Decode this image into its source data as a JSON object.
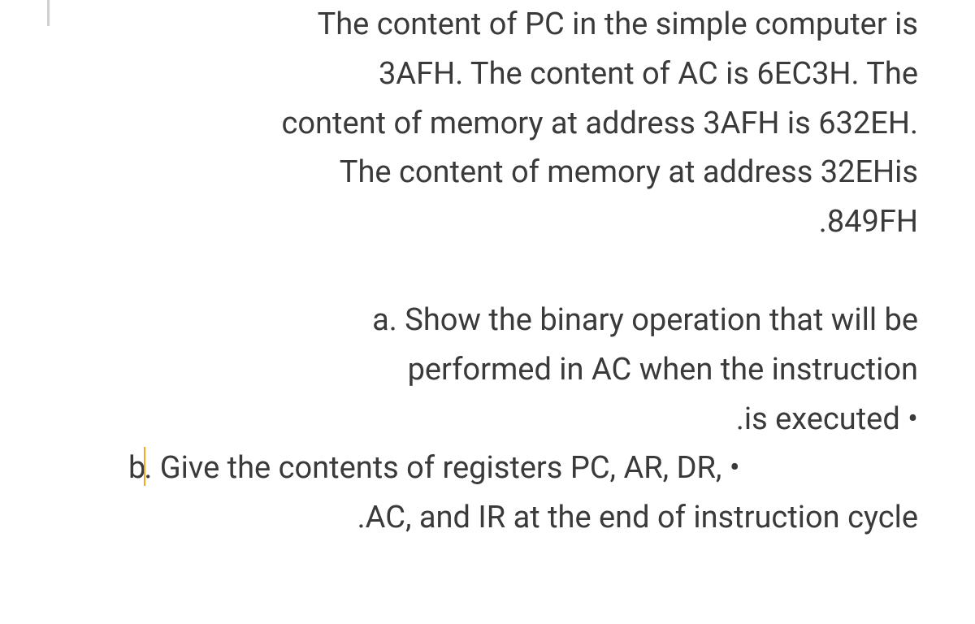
{
  "paragraph1": {
    "line1": "The content of PC in the simple computer is",
    "line2": "3AFH. The content of AC is 6EC3H. The",
    "line3": "content of memory at address 3AFH is 632EH.",
    "line4": "The content of memory at address 32EHis",
    "line5": ".849FH"
  },
  "question_a": {
    "line1": "a. Show the binary operation that will be",
    "line2": "performed in AC when the instruction",
    "line3": ".is executed •"
  },
  "question_b": {
    "prefix": "b",
    "line1_rest": ". Give the contents of registers PC, AR, DR, •",
    "line2": ".AC, and IR at the end of instruction cycle"
  }
}
